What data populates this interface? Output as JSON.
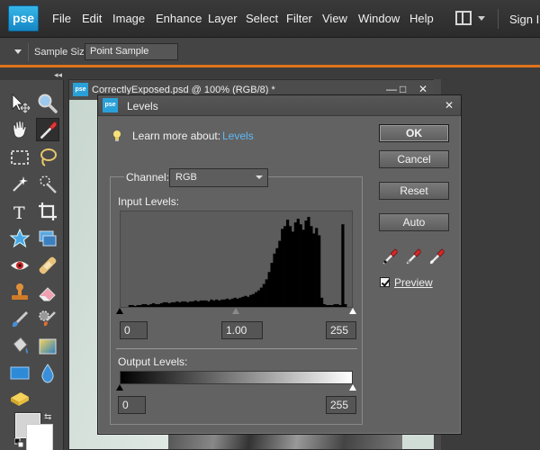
{
  "app": {
    "logo_text": "pse",
    "menu": [
      "File",
      "Edit",
      "Image",
      "Enhance",
      "Layer",
      "Select",
      "Filter",
      "View",
      "Window",
      "Help"
    ],
    "sign_in": "Sign In"
  },
  "options_bar": {
    "sample_size_label": "Sample Size:",
    "sample_size_value": "Point Sample"
  },
  "toolbox": {
    "tools": [
      "move-tool",
      "zoom-tool",
      "hand-tool",
      "eyedropper-tool",
      "rectangular-marquee-tool",
      "lasso-tool",
      "magic-wand-tool",
      "quick-selection-tool",
      "type-tool",
      "crop-tool",
      "custom-shape-tool",
      "recompose-tool",
      "red-eye-tool",
      "healing-brush-tool",
      "clone-stamp-tool",
      "eraser-tool",
      "brush-tool",
      "smart-brush-tool",
      "paint-bucket-tool",
      "gradient-tool",
      "shape-tool",
      "blur-tool",
      "sponge-tool"
    ],
    "selected": "eyedropper-tool",
    "foreground_color": "#d4d4d4",
    "background_color": "#ffffff"
  },
  "document": {
    "logo_text": "pse",
    "title": "CorrectlyExposed.psd @ 100% (RGB/8) *",
    "controls": [
      "—",
      "□",
      "✕"
    ]
  },
  "levels_dialog": {
    "logo_text": "pse",
    "title": "Levels",
    "close": "✕",
    "learn_more_label": "Learn more about:",
    "learn_more_link": "Levels",
    "channel_label": "Channel:",
    "channel_value": "RGB",
    "input_levels_label": "Input Levels:",
    "input_black": "0",
    "input_gamma": "1.00",
    "input_white": "255",
    "output_levels_label": "Output Levels:",
    "output_black": "0",
    "output_white": "255",
    "buttons": {
      "ok": "OK",
      "cancel": "Cancel",
      "reset": "Reset",
      "auto": "Auto"
    },
    "eyedroppers": [
      "black-point-eyedropper-icon",
      "gray-point-eyedropper-icon",
      "white-point-eyedropper-icon"
    ],
    "preview_label": "Preview",
    "preview_checked": true
  },
  "histogram": {
    "bins": [
      0,
      0,
      0,
      2,
      2,
      1,
      2,
      2,
      3,
      3,
      2,
      3,
      4,
      3,
      3,
      4,
      5,
      5,
      4,
      5,
      5,
      6,
      5,
      6,
      6,
      5,
      6,
      6,
      7,
      6,
      7,
      7,
      7,
      6,
      8,
      7,
      8,
      7,
      8,
      8,
      9,
      8,
      9,
      10,
      9,
      10,
      11,
      12,
      11,
      13,
      14,
      16,
      18,
      21,
      25,
      30,
      38,
      48,
      58,
      64,
      72,
      85,
      88,
      95,
      88,
      82,
      92,
      96,
      90,
      84,
      94,
      98,
      88,
      80,
      86,
      78,
      10,
      3,
      2,
      2,
      2,
      3,
      3,
      2,
      90,
      3,
      0,
      0
    ],
    "max": 100
  },
  "colors": {
    "accent_orange": "#e0731c",
    "link_blue": "#5fb8f7",
    "logo_blue": "#2aa0d8"
  }
}
